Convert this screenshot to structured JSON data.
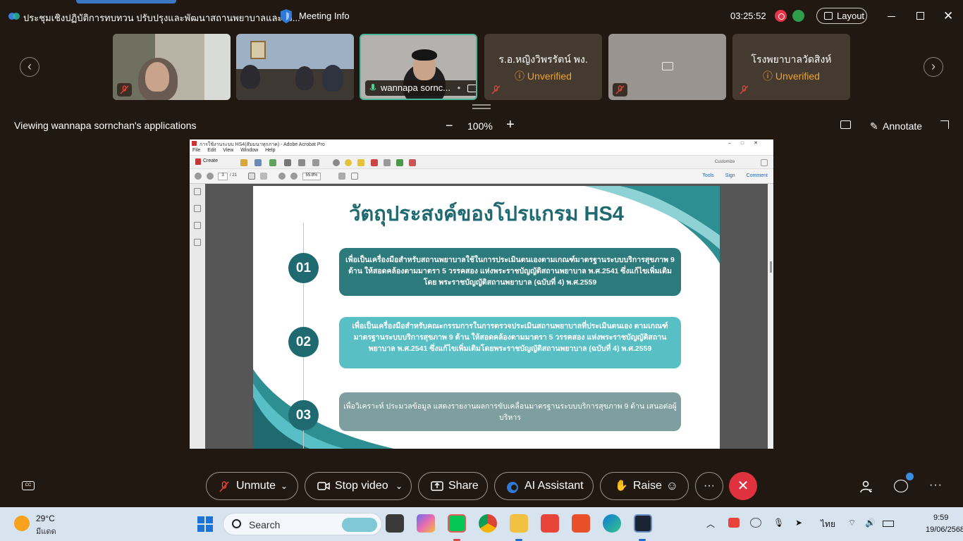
{
  "window": {
    "meeting_title": "ประชุมเชิงปฏิบัติการทบทวน ปรับปรุงและพัฒนาสถานพยาบาลและรว...",
    "meeting_info": "Meeting Info",
    "timer": "03:25:52",
    "layout_label": "Layout"
  },
  "participants": [
    {
      "name": "",
      "status": "",
      "video": true
    },
    {
      "name": "",
      "status": "",
      "video": true
    },
    {
      "name": "wannapa sornc...",
      "status": "",
      "video": true,
      "active": true
    },
    {
      "name": "ร.อ.หญิงวิพรรัตน์ พง.",
      "status": "Unverified",
      "video": false
    },
    {
      "name": "",
      "status": "",
      "video": false,
      "camera_off": true
    },
    {
      "name": "โรงพยาบาลวัดสิงห์",
      "status": "Unverified",
      "video": false
    }
  ],
  "share_bar": {
    "viewing": "Viewing wannapa sornchan's applications",
    "zoom": "100%",
    "annotate": "Annotate"
  },
  "acrobat": {
    "title": "การใช้งานระบบ HS4(สัมมนาทุกภาค) - Adobe Acrobat Pro",
    "menu": [
      "File",
      "Edit",
      "View",
      "Window",
      "Help"
    ],
    "create": "Create",
    "customize": "Customize",
    "page": "3",
    "page_total": "/ 21",
    "zoom": "55.8%",
    "pane_links": [
      "Tools",
      "Sign",
      "Comment"
    ]
  },
  "slide": {
    "title": "วัตถุประสงค์ของโปรแกรม HS4",
    "items": [
      {
        "num": "01",
        "text": "เพื่อเป็นเครื่องมือสำหรับสถานพยาบาลใช้ในการประเมินตนเองตามเกณฑ์มาตรฐานระบบบริการสุขภาพ 9 ด้าน ให้สอดคล้องตามมาตรา 5 วรรคสอง แห่งพระราชบัญญัติสถานพยาบาล พ.ศ.2541 ซึ่งแก้ไขเพิ่มเติมโดย พระราชบัญญัติสถานพยาบาล (ฉบับที่ 4) พ.ศ.2559"
      },
      {
        "num": "02",
        "text": "เพื่อเป็นเครื่องมือสำหรับคณะกรรมการในการตรวจประเมินสถานพยาบาลที่ประเมินตนเอง ตามเกณฑ์ มาตรฐานระบบบริการสุขภาพ 9 ด้าน ให้สอดคล้องตามมาตรา 5 วรรคสอง แห่งพระราชบัญญัติสถานพยาบาล พ.ศ.2541 ซึ่งแก้ไขเพิ่มเติมโดยพระราชบัญญัติสถานพยาบาล (ฉบับที่ 4) พ.ศ.2559"
      },
      {
        "num": "03",
        "text": "เพื่อวิเคราะห์ ประมวลข้อมูล แสดงรายงานผลการขับเคลื่อนมาตรฐานระบบบริการสุขภาพ 9 ด้าน เสนอต่อผู้บริหาร"
      }
    ]
  },
  "controls": {
    "unmute": "Unmute",
    "stop_video": "Stop video",
    "share": "Share",
    "ai_assistant": "AI Assistant",
    "raise": "Raise",
    "more": "···",
    "cc": "CC"
  },
  "taskbar": {
    "temp": "29°C",
    "weather": "มีแดด",
    "search": "Search",
    "lang": "ไทย",
    "time": "9:59",
    "date": "19/06/2568"
  },
  "colors": {
    "background": "#211911",
    "end_call": "#e0313f",
    "slide_teal": "#1f6a71",
    "unverified": "#e8a33c"
  }
}
